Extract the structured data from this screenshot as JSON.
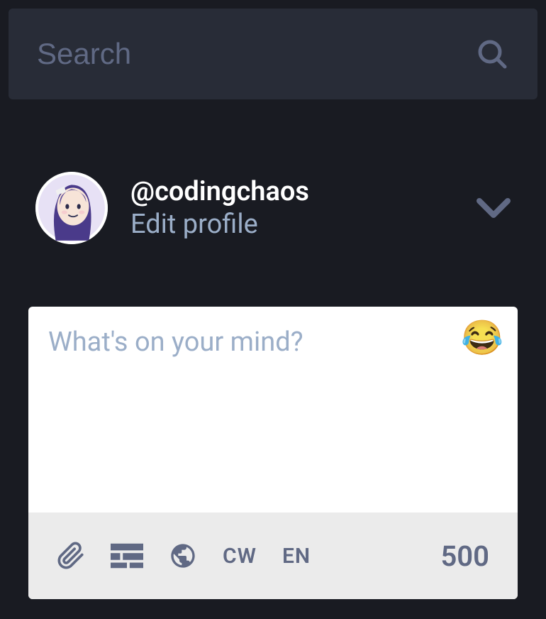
{
  "search": {
    "placeholder": "Search"
  },
  "profile": {
    "username": "@codingchaos",
    "edit_label": "Edit profile"
  },
  "compose": {
    "placeholder": "What's on your mind?",
    "char_count": "500",
    "cw_label": "CW",
    "lang_label": "EN"
  }
}
